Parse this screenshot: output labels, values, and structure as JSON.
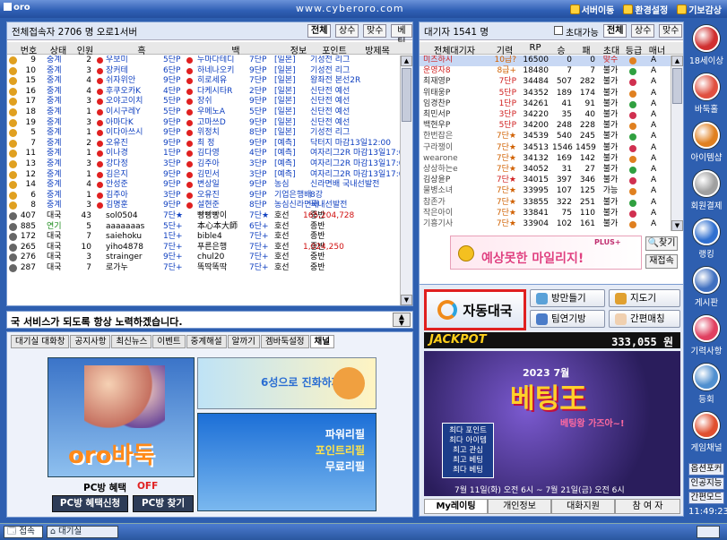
{
  "title": {
    "logo": "oro",
    "url": "www.cyberoro.com",
    "menu": [
      "서버이동",
      "환경설정",
      "기보감상"
    ]
  },
  "left_panel": {
    "header": "전체접속자  2706 명  오로1서버",
    "tabs": [
      "전체",
      "상수",
      "맞수",
      "베팅"
    ],
    "columns": [
      "번호",
      "상태",
      "인원",
      "흑",
      "백",
      "정보",
      "포인트",
      "방제목"
    ],
    "rows": [
      {
        "no": "9",
        "state": "중계",
        "n": "2",
        "black": "우보미",
        "brank": "5단P",
        "white": "누마다테디",
        "wrank": "7단P",
        "info": "[일본]",
        "title": "기성전 리그",
        "pt": ""
      },
      {
        "no": "10",
        "state": "중계",
        "n": "3",
        "black": "장커테",
        "brank": "6단P",
        "white": "하네나오키",
        "wrank": "9단P",
        "info": "[일본]",
        "title": "기성전 리그",
        "pt": ""
      },
      {
        "no": "15",
        "state": "중계",
        "n": "4",
        "black": "쉬자위안",
        "brank": "9단P",
        "white": "히로세유",
        "wrank": "7단P",
        "info": "[일본]",
        "title": "왕좌전 본선2R",
        "pt": ""
      },
      {
        "no": "16",
        "state": "중계",
        "n": "4",
        "black": "후쿠오카K",
        "brank": "4단P",
        "white": "다케시타R",
        "wrank": "2단P",
        "info": "[일본]",
        "title": "신단전 예선",
        "pt": ""
      },
      {
        "no": "17",
        "state": "중계",
        "n": "3",
        "black": "오야고이치",
        "brank": "5단P",
        "white": "장쉬",
        "wrank": "9단P",
        "info": "[일본]",
        "title": "신단전 예선",
        "pt": ""
      },
      {
        "no": "18",
        "state": "중계",
        "n": "1",
        "black": "이시구레Y",
        "brank": "5단P",
        "white": "우메노A",
        "wrank": "5단P",
        "info": "[일본]",
        "title": "신단전 예선",
        "pt": ""
      },
      {
        "no": "19",
        "state": "중계",
        "n": "3",
        "black": "아마다K",
        "brank": "9단P",
        "white": "고마쓰D",
        "wrank": "9단P",
        "info": "[일본]",
        "title": "신단전 예선",
        "pt": ""
      },
      {
        "no": "5",
        "state": "중계",
        "n": "1",
        "black": "이다아쓰시",
        "brank": "9단P",
        "white": "위정치",
        "wrank": "8단P",
        "info": "[일본]",
        "title": "기성전 리그",
        "pt": ""
      },
      {
        "no": "7",
        "state": "중계",
        "n": "2",
        "black": "오유진",
        "brank": "9단P",
        "white": "최 정",
        "wrank": "9단P",
        "info": "[예측]",
        "title": "닥터지 마감13일12:00",
        "pt": ""
      },
      {
        "no": "11",
        "state": "중계",
        "n": "1",
        "black": "이나경",
        "brank": "1단P",
        "white": "김다영",
        "wrank": "4단P",
        "info": "[예측]",
        "title": "여자리그2R 마감13일17:0",
        "pt": ""
      },
      {
        "no": "13",
        "state": "중계",
        "n": "3",
        "black": "강다정",
        "brank": "3단P",
        "white": "김주아",
        "wrank": "3단P",
        "info": "[예측]",
        "title": "여자리그2R 마감13일17:0",
        "pt": ""
      },
      {
        "no": "12",
        "state": "중계",
        "n": "1",
        "black": "김은지",
        "brank": "9단P",
        "white": "김민서",
        "wrank": "3단P",
        "info": "[예측]",
        "title": "여자리그2R 마감13일17:0",
        "pt": ""
      },
      {
        "no": "14",
        "state": "중계",
        "n": "4",
        "black": "안성준",
        "brank": "9단P",
        "white": "변상일",
        "wrank": "9단P",
        "info": "농심",
        "title": "신라면배 국내선발전",
        "pt": ""
      },
      {
        "no": "6",
        "state": "중계",
        "n": "1",
        "black": "김주아",
        "brank": "3단P",
        "white": "오유진",
        "wrank": "9단P",
        "info": "기업은행배",
        "title": "8강",
        "pt": ""
      },
      {
        "no": "8",
        "state": "중계",
        "n": "3",
        "black": "김명훈",
        "brank": "9단P",
        "white": "설현준",
        "wrank": "8단P",
        "info": "농심신라면배",
        "title": "국내선발전",
        "pt": ""
      },
      {
        "no": "407",
        "state": "대국",
        "n": "43",
        "black": "sol0504",
        "brank": "7단★",
        "white": "빵빵빵이",
        "wrank": "7단★",
        "info": "호선",
        "title": "중반",
        "pt": "165,204,728"
      },
      {
        "no": "885",
        "state": "연기",
        "n": "5",
        "black": "aaaaaaas",
        "brank": "5단+",
        "white": "本心本大師",
        "wrank": "6단+",
        "info": "호선",
        "title": "종반",
        "pt": ""
      },
      {
        "no": "172",
        "state": "대국",
        "n": "7",
        "black": "saiehoku",
        "brank": "1단+",
        "white": "bible4",
        "wrank": "7단+",
        "info": "호선",
        "title": "종반",
        "pt": ""
      },
      {
        "no": "265",
        "state": "대국",
        "n": "10",
        "black": "yiho4878",
        "brank": "7단+",
        "white": "푸른은행",
        "wrank": "7단+",
        "info": "호선",
        "title": "종반",
        "pt": "1,024,250"
      },
      {
        "no": "276",
        "state": "대국",
        "n": "3",
        "black": "strainger",
        "brank": "9단+",
        "white": "chul20",
        "wrank": "7단+",
        "info": "호선",
        "title": "중반",
        "pt": ""
      },
      {
        "no": "287",
        "state": "대국",
        "n": "7",
        "black": "로가누",
        "brank": "7단+",
        "white": "똑딱똑딱",
        "wrank": "7단+",
        "info": "호선",
        "title": "중반",
        "pt": ""
      }
    ]
  },
  "right_panel": {
    "header": "대기자    1541 명",
    "options": [
      "초대가능",
      "전체",
      "상수",
      "맞수"
    ],
    "columns": [
      "전체대기자",
      "기력",
      "RP",
      "승",
      "패",
      "초대",
      "등급",
      "매너"
    ],
    "rows": [
      {
        "name": "미츠하시",
        "rank": "10급?",
        "rp": "16500",
        "w": "0",
        "l": "0",
        "inv": "맞수"
      },
      {
        "name": "운영자8",
        "rank": "8급+",
        "rp": "18480",
        "w": "7",
        "l": "7",
        "inv": "불가"
      },
      {
        "name": "최재영P",
        "rank": "7단P",
        "rp": "34484",
        "w": "507",
        "l": "282",
        "inv": "불가"
      },
      {
        "name": "위태웅P",
        "rank": "5단P",
        "rp": "34352",
        "w": "189",
        "l": "174",
        "inv": "불가"
      },
      {
        "name": "임경찬P",
        "rank": "1단P",
        "rp": "34261",
        "w": "41",
        "l": "91",
        "inv": "불가"
      },
      {
        "name": "최민서P",
        "rank": "3단P",
        "rp": "34220",
        "w": "35",
        "l": "40",
        "inv": "불가"
      },
      {
        "name": "백현우P",
        "rank": "5단P",
        "rp": "34200",
        "w": "248",
        "l": "228",
        "inv": "불가"
      },
      {
        "name": "한번잡은",
        "rank": "7단★",
        "rp": "34539",
        "w": "540",
        "l": "245",
        "inv": "불가"
      },
      {
        "name": "구라쟁이",
        "rank": "7단★",
        "rp": "34513",
        "w": "1546",
        "l": "1459",
        "inv": "불가"
      },
      {
        "name": "wearone",
        "rank": "7단★",
        "rp": "34132",
        "w": "169",
        "l": "142",
        "inv": "불가"
      },
      {
        "name": "상상하는e",
        "rank": "7단★",
        "rp": "34052",
        "w": "31",
        "l": "27",
        "inv": "불가"
      },
      {
        "name": "김상윤P",
        "rank": "7단★",
        "rp": "34015",
        "w": "397",
        "l": "346",
        "inv": "불가"
      },
      {
        "name": "물병소녀",
        "rank": "7단★",
        "rp": "33995",
        "w": "107",
        "l": "125",
        "inv": "가능"
      },
      {
        "name": "참존가",
        "rank": "7단★",
        "rp": "33855",
        "w": "322",
        "l": "251",
        "inv": "불가"
      },
      {
        "name": "작은아이",
        "rank": "7단★",
        "rp": "33841",
        "w": "75",
        "l": "110",
        "inv": "불가"
      },
      {
        "name": "기흥기사",
        "rank": "7단★",
        "rp": "33904",
        "w": "102",
        "l": "161",
        "inv": "불가"
      }
    ],
    "find_btn": "찾기",
    "refresh_btn": "재접속",
    "banner_text": "예상못한 마일리지!",
    "banner_tag": "PLUS+"
  },
  "notice": "국 서비스가 되도록 항상 노력하겠습니다.",
  "bottom_tabs": [
    "대기실 대화창",
    "공지사항",
    "최신뉴스",
    "이벤트",
    "중계해설",
    "알까기",
    "겜바둑설정",
    "채널"
  ],
  "promo": {
    "logo": "oro바둑",
    "pc_benefit_label": "PC방 혜택",
    "pc_benefit_value": "OFF",
    "pc_apply": "PC방 혜택신청",
    "pc_find": "PC방 찾기",
    "ad1_text": "6성으로 진화하자!!",
    "ad2_line1": "파워리필",
    "ad2_line2": "포인트리필",
    "ad2_line3": "무료리필"
  },
  "actions": {
    "auto_match": "자동대국",
    "make_room": "방만들기",
    "hint": "지도기",
    "enter_room": "팀연기방",
    "simple_play": "간편매칭"
  },
  "jackpot": {
    "label": "JACKPOT",
    "amount": "333,055 원"
  },
  "event": {
    "year": "2023 7월",
    "title": "베팅王",
    "sub": "베팅왕 가즈아~!",
    "lines": [
      "최다 포인트",
      "최다 아이템",
      "최고 관심",
      "최고 베팅",
      "최다 베팅"
    ],
    "date": "7월 11일(화) 오전 6시 ~ 7월 21일(금) 오전 6시"
  },
  "right_tabs": [
    "My레이팅",
    "개인정보",
    "대화지원",
    "참 여 자"
  ],
  "sidebar": [
    {
      "label": "18세이상",
      "color": "#d03030"
    },
    {
      "label": "바둑홀",
      "color": "#e05040"
    },
    {
      "label": "아이템샵",
      "color": "#e08020"
    },
    {
      "label": "회원결제",
      "color": "#a0a0a0"
    },
    {
      "label": "랭킹",
      "color": "#3070d0"
    },
    {
      "label": "게시판",
      "color": "#4070c0"
    },
    {
      "label": "기력사항",
      "color": "#e04060"
    },
    {
      "label": "등회",
      "color": "#5090d0"
    },
    {
      "label": "게임채널",
      "color": "#e05030"
    }
  ],
  "sidebar_bottom": [
    "옵션포커",
    "인공지능",
    "간편모드",
    "11:49:23"
  ],
  "taskbar": {
    "items": [
      "접속",
      "대기실"
    ]
  }
}
